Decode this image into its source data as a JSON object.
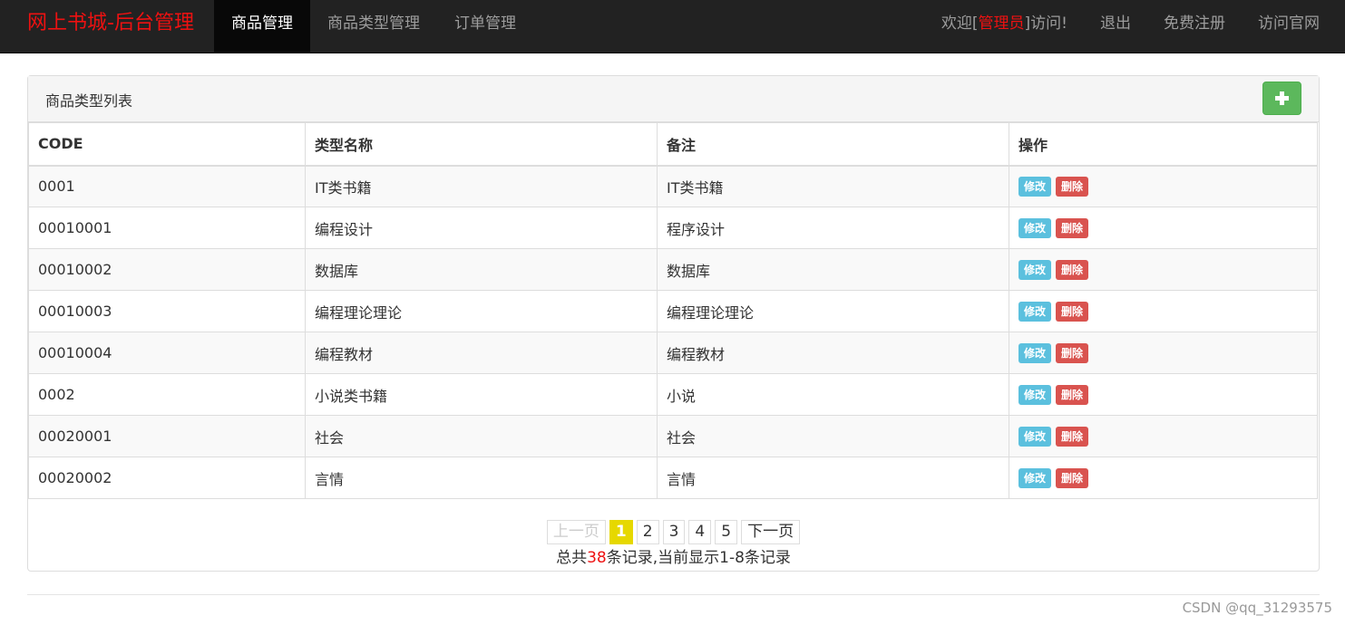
{
  "nav": {
    "brand": "网上书城-后台管理",
    "items": [
      {
        "label": "商品管理",
        "active": true
      },
      {
        "label": "商品类型管理",
        "active": false
      },
      {
        "label": "订单管理",
        "active": false
      }
    ],
    "welcome_prefix": "欢迎[",
    "admin_name": "管理员",
    "welcome_suffix": "]访问!",
    "logout": "退出",
    "register": "免费注册",
    "official_site": "访问官网"
  },
  "panel": {
    "title": "商品类型列表",
    "add_icon": "plus-icon"
  },
  "table": {
    "headers": [
      "CODE",
      "类型名称",
      "备注",
      "操作"
    ],
    "rows": [
      {
        "code": "0001",
        "name": "IT类书籍",
        "note": "IT类书籍"
      },
      {
        "code": "00010001",
        "name": "编程设计",
        "note": "程序设计"
      },
      {
        "code": "00010002",
        "name": "数据库",
        "note": "数据库"
      },
      {
        "code": "00010003",
        "name": "编程理论理论",
        "note": "编程理论理论"
      },
      {
        "code": "00010004",
        "name": "编程教材",
        "note": "编程教材"
      },
      {
        "code": "0002",
        "name": "小说类书籍",
        "note": "小说"
      },
      {
        "code": "00020001",
        "name": "社会",
        "note": "社会"
      },
      {
        "code": "00020002",
        "name": "言情",
        "note": "言情"
      }
    ],
    "edit_label": "修改",
    "delete_label": "删除"
  },
  "pagination": {
    "prev": "上一页",
    "pages": [
      "1",
      "2",
      "3",
      "4",
      "5"
    ],
    "current": "1",
    "next": "下一页",
    "info_prefix": "总共",
    "total": "38",
    "info_suffix": "条记录,当前显示1-8条记录"
  },
  "watermark": "CSDN @qq_31293575",
  "colors": {
    "navbar": "#222222",
    "brand": "#ee1111",
    "add_button": "#5cb85c",
    "edit_button": "#5bc0de",
    "delete_button": "#d9534f",
    "current_page": "#e6d800"
  }
}
